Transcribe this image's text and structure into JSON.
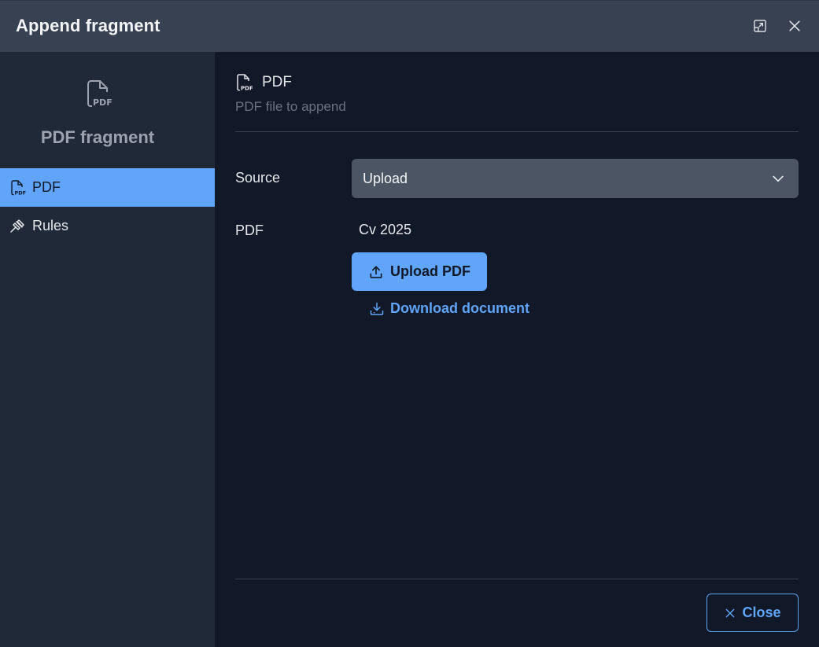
{
  "header": {
    "title": "Append fragment",
    "expand_icon": "expand-icon",
    "close_icon": "close-icon"
  },
  "sidebar": {
    "icon": "pdf-file-icon",
    "title": "PDF fragment",
    "items": [
      {
        "label": "PDF",
        "icon": "pdf-file-icon",
        "active": true
      },
      {
        "label": "Rules",
        "icon": "gavel-icon",
        "active": false
      }
    ]
  },
  "main": {
    "section_title": "PDF",
    "section_subtitle": "PDF file to append",
    "source_label": "Source",
    "source_value": "Upload",
    "pdf_label": "PDF",
    "pdf_value": "Cv 2025",
    "upload_label": "Upload PDF",
    "download_label": "Download document",
    "close_label": "Close"
  },
  "colors": {
    "accent": "#60a5fa",
    "header_bg": "#374151",
    "sidebar_bg": "#1f2937",
    "main_bg": "#111827",
    "select_bg": "#4b5563"
  }
}
